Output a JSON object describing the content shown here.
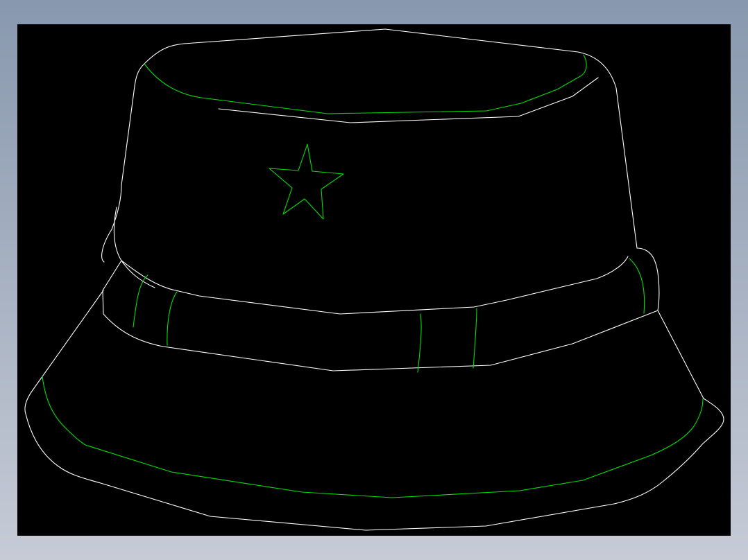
{
  "viewer": {
    "background_top": "#8898ae",
    "background_bottom": "#c6cbd6",
    "canvas_color": "#000000"
  },
  "drawing": {
    "subject": "bucket-hat-icon",
    "colors": {
      "outline": "#ffffff",
      "detail": "#00e000"
    },
    "elements": [
      {
        "name": "hat-crown-outline",
        "layer": "outline"
      },
      {
        "name": "crown-top-seam",
        "layer": "detail"
      },
      {
        "name": "crown-top-brim-line",
        "layer": "outline"
      },
      {
        "name": "star-emblem",
        "layer": "detail"
      },
      {
        "name": "hat-band-top-edge",
        "layer": "outline"
      },
      {
        "name": "hat-band-bottom-edge",
        "layer": "outline"
      },
      {
        "name": "band-loops",
        "layer": "detail"
      },
      {
        "name": "hat-brim-outline",
        "layer": "outline"
      },
      {
        "name": "brim-stitch-line",
        "layer": "detail"
      }
    ]
  }
}
